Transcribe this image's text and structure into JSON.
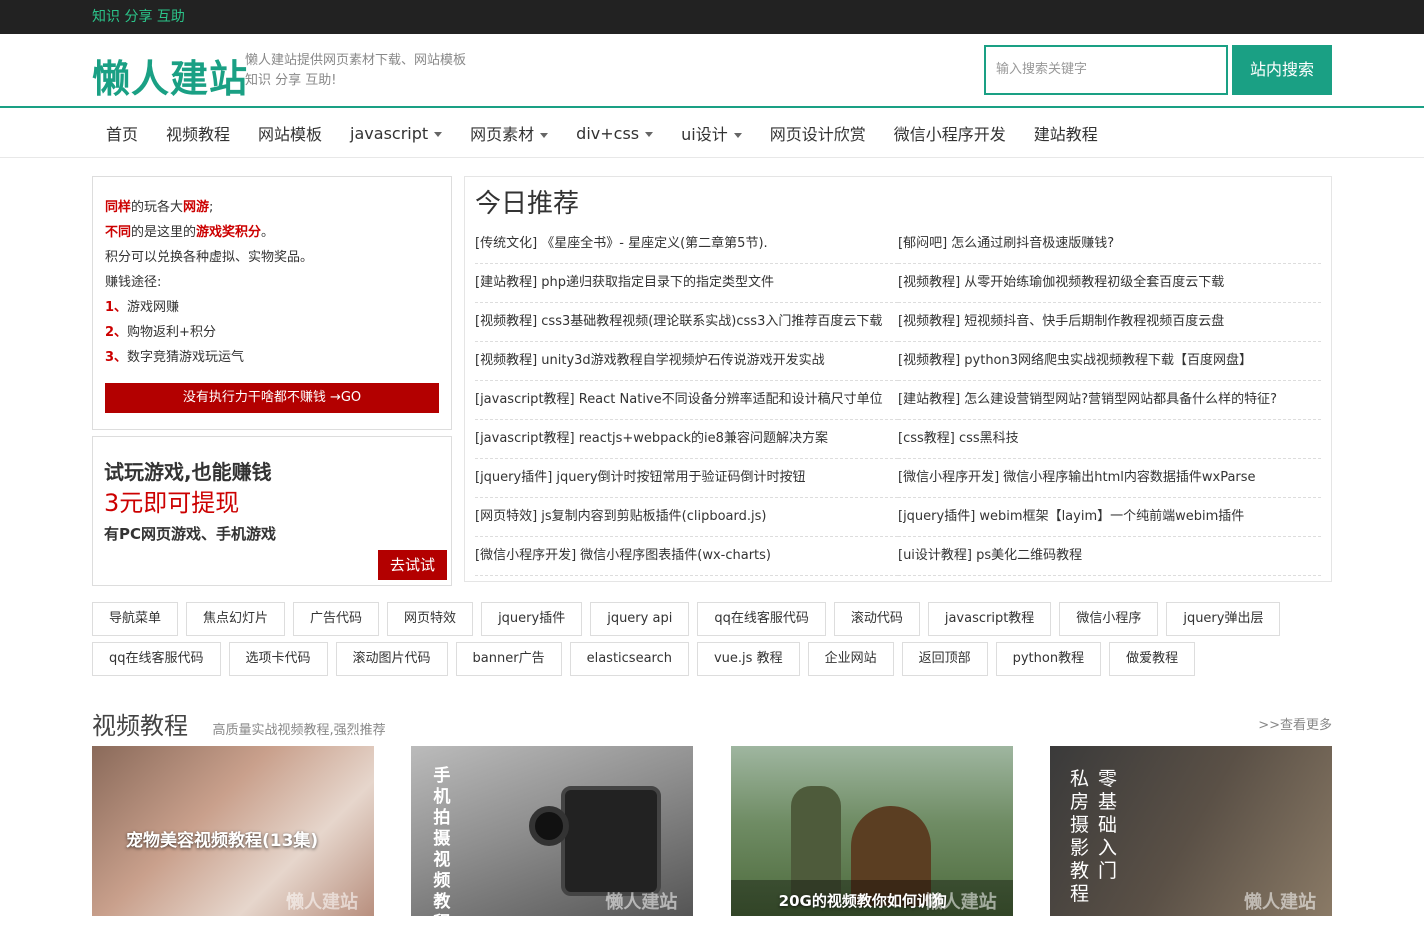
{
  "topbar": {
    "text": "知识 分享 互助"
  },
  "header": {
    "logo": "懒人建站",
    "slogan_line1": "懒人建站提供网页素材下载、网站模板",
    "slogan_line2": "知识 分享 互助!",
    "search_placeholder": "输入搜索关键字",
    "search_button": "站内搜索"
  },
  "nav": [
    {
      "label": "首页",
      "caret": false
    },
    {
      "label": "视频教程",
      "caret": false
    },
    {
      "label": "网站模板",
      "caret": false
    },
    {
      "label": "javascript",
      "caret": true
    },
    {
      "label": "网页素材",
      "caret": true
    },
    {
      "label": "div+css",
      "caret": true
    },
    {
      "label": "ui设计",
      "caret": true
    },
    {
      "label": "网页设计欣赏",
      "caret": false
    },
    {
      "label": "微信小程序开发",
      "caret": false
    },
    {
      "label": "建站教程",
      "caret": false
    }
  ],
  "promo1": {
    "l1a": "同样",
    "l1b": "的玩各大",
    "l1c": "网游",
    "l1d": ";",
    "l2a": "不同",
    "l2b": "的是这里的",
    "l2c": "游戏奖积分",
    "l2d": "。",
    "l3": "积分可以兑换各种虚拟、实物奖品。",
    "l4": "赚钱途径:",
    "w1n": "1、",
    "w1": "游戏网赚",
    "w2n": "2、",
    "w2": "购物返利+积分",
    "w3n": "3、",
    "w3": "数字竞猜游戏玩运气",
    "button": "没有执行力干啥都不赚钱 →GO"
  },
  "promo2": {
    "l1": "试玩游戏,也能赚钱",
    "l2": "3元即可提现",
    "l3": "有PC网页游戏、手机游戏",
    "button": "去试试"
  },
  "recommend": {
    "title": "今日推荐",
    "items": [
      "[传统文化] 《星座全书》- 星座定义(第二章第5节).",
      "[郁闷吧] 怎么通过刷抖音极速版赚钱?",
      "[建站教程] php递归获取指定目录下的指定类型文件",
      "[视频教程] 从零开始练瑜伽视频教程初级全套百度云下载",
      "[视频教程] css3基础教程视频(理论联系实战)css3入门推荐百度云下载",
      "[视频教程] 短视频抖音、快手后期制作教程视频百度云盘",
      "[视频教程] unity3d游戏教程自学视频炉石传说游戏开发实战",
      "[视频教程] python3网络爬虫实战视频教程下载【百度网盘】",
      "[javascript教程] React Native不同设备分辨率适配和设计稿尺寸单位",
      "[建站教程] 怎么建设营销型网站?营销型网站都具备什么样的特征?",
      "[javascript教程] reactjs+webpack的ie8兼容问题解决方案",
      "[css教程] css黑科技",
      "[jquery插件] jquery倒计时按钮常用于验证码倒计时按钮",
      "[微信小程序开发] 微信小程序输出html内容数据插件wxParse",
      "[网页特效] js复制内容到剪贴板插件(clipboard.js)",
      "[jquery插件] webim框架【layim】一个纯前端webim插件",
      "[微信小程序开发] 微信小程序图表插件(wx-charts)",
      "[ui设计教程] ps美化二维码教程"
    ]
  },
  "tags": [
    "导航菜单",
    "焦点幻灯片",
    "广告代码",
    "网页特效",
    "jquery插件",
    "jquery api",
    "qq在线客服代码",
    "滚动代码",
    "javascript教程",
    "微信小程序",
    "jquery弹出层",
    "qq在线客服代码",
    "选项卡代码",
    "滚动图片代码",
    "banner广告",
    "elasticsearch",
    "vue.js 教程",
    "企业网站",
    "返回顶部",
    "python教程",
    "做爱教程"
  ],
  "video": {
    "title": "视频教程",
    "subtitle": "高质量实战视频教程,强烈推荐",
    "more": ">>查看更多",
    "thumb1_caption": "宠物美容视频教程(13集)",
    "thumb2_caption": "手机拍摄视频教程",
    "thumb3_caption": "20G的视频教你如何训狗",
    "thumb4_col1": "私房摄影教程",
    "thumb4_col2": "零基础入门",
    "watermark": "懒人建站"
  }
}
